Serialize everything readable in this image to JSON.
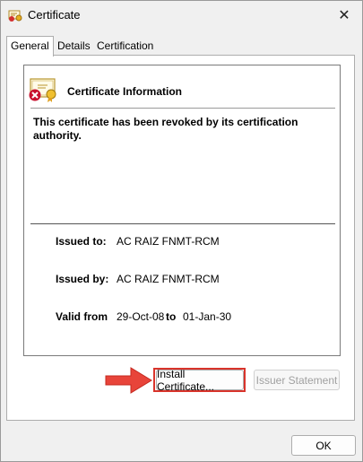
{
  "window": {
    "title": "Certificate",
    "close_glyph": "✕"
  },
  "tabs": [
    {
      "label": "General"
    },
    {
      "label": "Details"
    },
    {
      "label": "Certification Path"
    }
  ],
  "info": {
    "heading": "Certificate Information",
    "message": "This certificate has been revoked by its certification authority.",
    "issued_to_label": "Issued to:",
    "issued_to_value": "AC RAIZ FNMT-RCM",
    "issued_by_label": "Issued by:",
    "issued_by_value": "AC RAIZ FNMT-RCM",
    "valid_from_label": "Valid from",
    "valid_from_value": "29-Oct-08",
    "valid_to_label": "to",
    "valid_to_value": "01-Jan-30"
  },
  "buttons": {
    "install": "Install Certificate...",
    "issuer": "Issuer Statement",
    "ok": "OK"
  },
  "icons": {
    "title": "certificate-icon",
    "info": "revoked-certificate-icon",
    "close": "close-icon",
    "annotation": "red-arrow"
  },
  "colors": {
    "annotation": "#d9342b",
    "error": "#c8102e"
  }
}
